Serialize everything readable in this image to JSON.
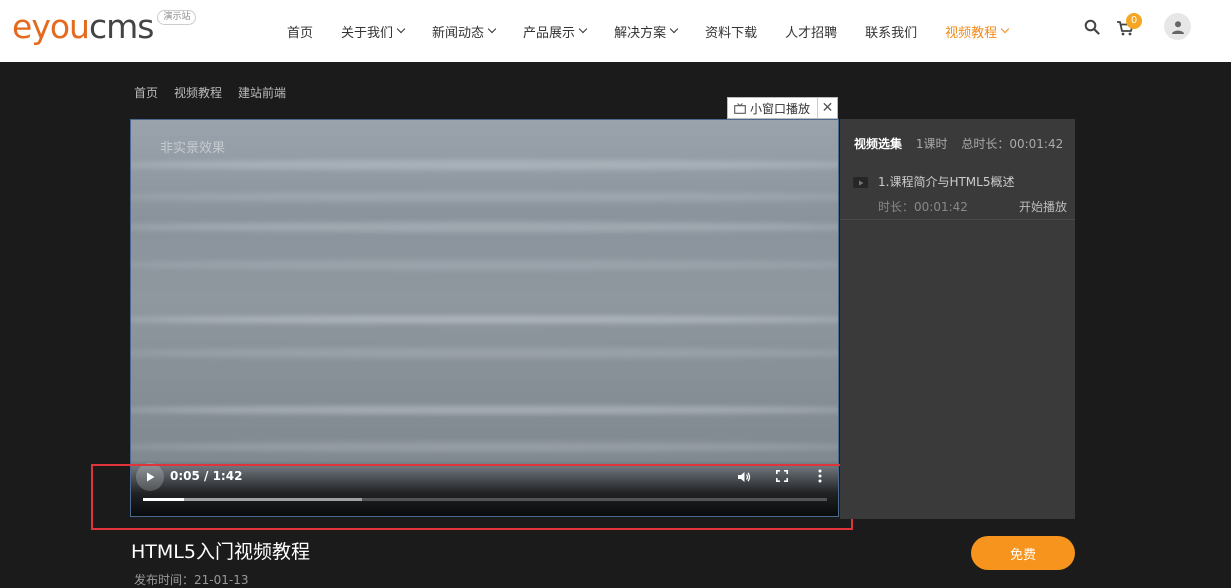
{
  "header": {
    "logo": {
      "text_a": "e",
      "text_b": "you",
      "text_c": "cms",
      "badge": "演示站"
    },
    "nav": [
      {
        "label": "首页",
        "dropdown": false
      },
      {
        "label": "关于我们",
        "dropdown": true
      },
      {
        "label": "新闻动态",
        "dropdown": true
      },
      {
        "label": "产品展示",
        "dropdown": true
      },
      {
        "label": "解决方案",
        "dropdown": true
      },
      {
        "label": "资料下载",
        "dropdown": false
      },
      {
        "label": "人才招聘",
        "dropdown": false
      },
      {
        "label": "联系我们",
        "dropdown": false
      },
      {
        "label": "视频教程",
        "dropdown": true,
        "active": true
      }
    ],
    "cart_count": "0",
    "accent_color": "#f18b1b"
  },
  "breadcrumb": [
    "首页",
    "视频教程",
    "建站前端"
  ],
  "mini_window": {
    "label": "小窗口播放",
    "close": "✕"
  },
  "video": {
    "watermark": "非实景效果",
    "time_display": "0:05 / 1:42",
    "played_fraction": 0.06,
    "buffered_fraction": 0.32
  },
  "playlist": {
    "title": "视频选集",
    "count": "1课时",
    "total": "总时长：00:01:42",
    "items": [
      {
        "title": "1.课程简介与HTML5概述",
        "duration": "时长：00:01:42",
        "action": "开始播放"
      }
    ]
  },
  "course": {
    "title": "HTML5入门视频教程",
    "published": "发布时间：21-01-13",
    "button": "免费"
  }
}
